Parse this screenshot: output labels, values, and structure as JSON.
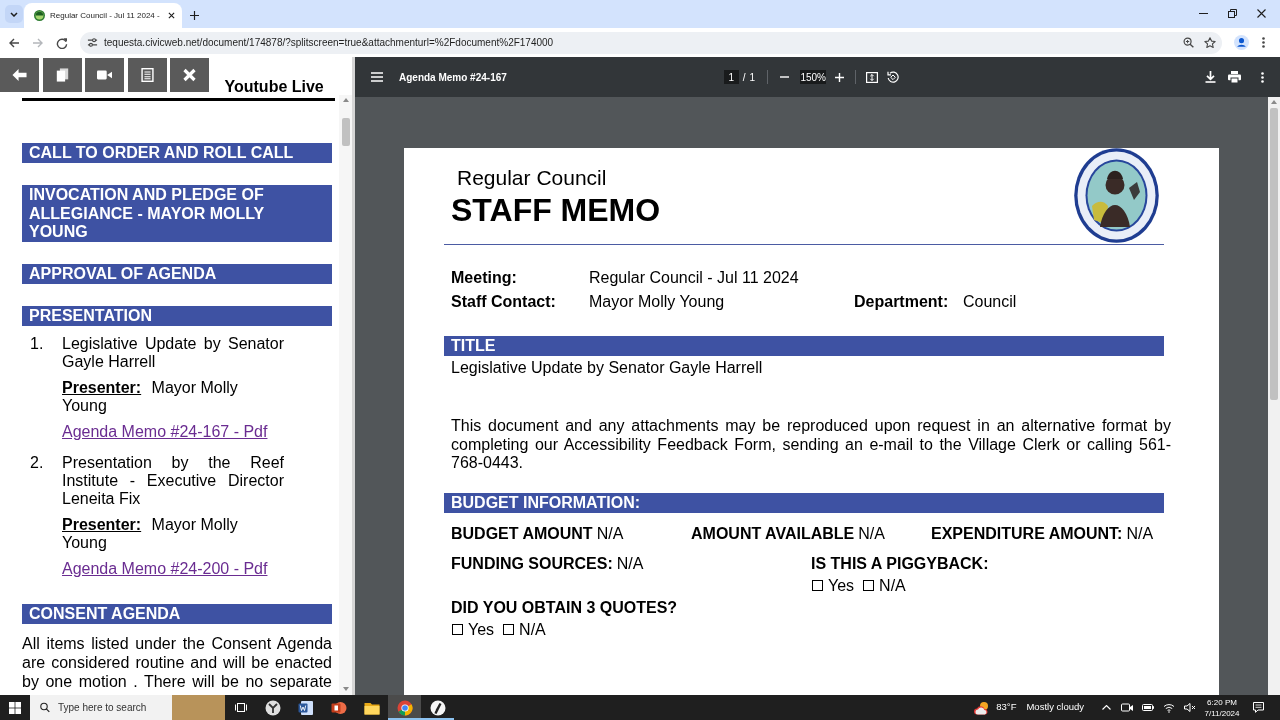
{
  "browser": {
    "tabs": [
      {
        "title": "Regular Council - Jul 11 2024 -",
        "selected": true
      }
    ],
    "nav_buttons": [
      {
        "kind": "back",
        "disabled": false
      },
      {
        "kind": "forward",
        "disabled": true
      },
      {
        "kind": "reload",
        "disabled": false
      }
    ],
    "address": "tequesta.civicweb.net/document/174878/?splitscreen=true&attachmenturl=%2Fdocument%2F174000"
  },
  "agenda": {
    "banner": "Youtube Live",
    "sections": [
      {
        "heading": "CALL TO ORDER AND ROLL CALL"
      },
      {
        "heading": "INVOCATION AND PLEDGE OF ALLEGIANCE - MAYOR MOLLY YOUNG"
      },
      {
        "heading": "APPROVAL OF AGENDA"
      },
      {
        "heading": "PRESENTATION",
        "items": [
          {
            "number": "1.",
            "text": "Legislative Update by Senator Gayle Harrell",
            "presenter": "**Presenter:** Mayor Molly Young",
            "link": "Agenda Memo #24-167 - Pdf"
          },
          {
            "number": "2.",
            "text": "Presentation by the Reef Institute - Executive Director Leneita Fix",
            "presenter": "**Presenter:** Mayor Molly Young",
            "link": "Agenda Memo #24-200 - Pdf"
          }
        ]
      },
      {
        "heading": "CONSENT AGENDA",
        "text": "All items listed under the Consent Agenda are considered routine and will be enacted by one motion . There will be no separate"
      }
    ]
  },
  "pdf_viewer": {
    "title": "Agenda Memo #24-167",
    "page": "1",
    "separator": "/",
    "page_count": "1",
    "zoom": "150%"
  },
  "document": {
    "subtitle": "Regular Council",
    "title": "STAFF MEMO",
    "fields": [
      {
        "label": "Meeting:",
        "value": "Regular Council - Jul 11 2024"
      },
      {
        "label": "Staff Contact:",
        "value": "Mayor Molly Young"
      },
      {
        "label": "Department:",
        "value": "Council"
      }
    ],
    "title_section": {
      "heading": "TITLE",
      "text": "Legislative Update by Senator Gayle Harrell"
    },
    "notice": "This document and any attachments may be reproduced upon request in an alternative format by completing our Accessibility Feedback Form, sending an e-mail to the Village Clerk or calling 561-768-0443.",
    "budget": {
      "heading": "BUDGET INFORMATION:",
      "amounts": [
        {
          "label": "BUDGET AMOUNT",
          "value": "N/A"
        },
        {
          "label": "AMOUNT AVAILABLE",
          "value": "N/A"
        },
        {
          "label": "EXPENDITURE AMOUNT:",
          "value": "N/A"
        }
      ],
      "funding": {
        "label": "FUNDING SOURCES:",
        "value": "N/A"
      },
      "questions": [
        {
          "label": "IS THIS A PIGGYBACK:",
          "options": [
            {
              "label": "Yes",
              "checked": false
            },
            {
              "label": "N/A",
              "checked": false
            }
          ]
        },
        {
          "label": "DID YOU OBTAIN 3 QUOTES?",
          "options": [
            {
              "label": "Yes",
              "checked": false
            },
            {
              "label": "N/A",
              "checked": false
            }
          ]
        }
      ]
    }
  },
  "taskbar": {
    "search": {
      "placeholder": "Type here to search"
    },
    "apps": [
      {
        "running": false,
        "active": false
      },
      {
        "running": false,
        "active": false
      },
      {
        "running": false,
        "active": false
      },
      {
        "running": false,
        "active": false
      },
      {
        "running": true,
        "active": true
      },
      {
        "running": true,
        "active": false
      }
    ],
    "weather": {
      "temperature": "83°F",
      "condition": "Mostly cloudy"
    },
    "clock": {
      "time": "6:20 PM",
      "date": "7/11/2024"
    }
  }
}
